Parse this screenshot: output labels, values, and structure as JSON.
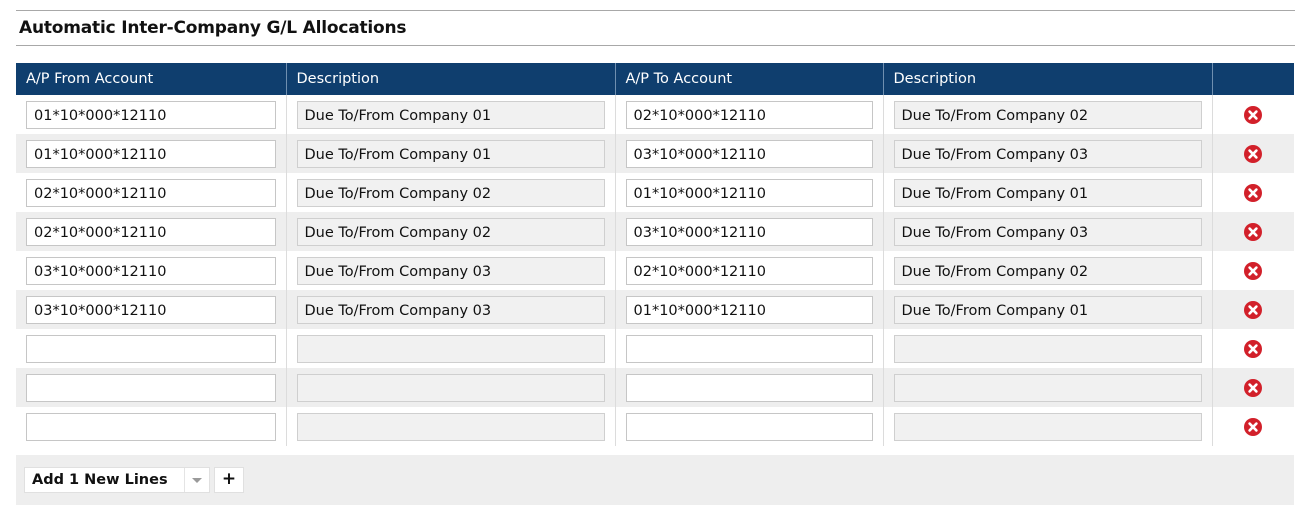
{
  "section": {
    "title": "Automatic Inter-Company G/L Allocations"
  },
  "table": {
    "headers": [
      "A/P From Account",
      "Description",
      "A/P To Account",
      "Description",
      ""
    ],
    "rows": [
      {
        "from_account": "01*10*000*12110",
        "from_description": "Due To/From Company 01",
        "to_account": "02*10*000*12110",
        "to_description": "Due To/From Company 02"
      },
      {
        "from_account": "01*10*000*12110",
        "from_description": "Due To/From Company 01",
        "to_account": "03*10*000*12110",
        "to_description": "Due To/From Company 03"
      },
      {
        "from_account": "02*10*000*12110",
        "from_description": "Due To/From Company 02",
        "to_account": "01*10*000*12110",
        "to_description": "Due To/From Company 01"
      },
      {
        "from_account": "02*10*000*12110",
        "from_description": "Due To/From Company 02",
        "to_account": "03*10*000*12110",
        "to_description": "Due To/From Company 03"
      },
      {
        "from_account": "03*10*000*12110",
        "from_description": "Due To/From Company 03",
        "to_account": "02*10*000*12110",
        "to_description": "Due To/From Company 02"
      },
      {
        "from_account": "03*10*000*12110",
        "from_description": "Due To/From Company 03",
        "to_account": "01*10*000*12110",
        "to_description": "Due To/From Company 01"
      },
      {
        "from_account": "",
        "from_description": "",
        "to_account": "",
        "to_description": ""
      },
      {
        "from_account": "",
        "from_description": "",
        "to_account": "",
        "to_description": ""
      },
      {
        "from_account": "",
        "from_description": "",
        "to_account": "",
        "to_description": ""
      }
    ],
    "delete_icon": "circle-x-icon"
  },
  "footer": {
    "add_lines_label": "Add 1 New Lines",
    "add_button_label": "+"
  },
  "colors": {
    "header_bg": "#0f3e6e",
    "delete_icon": "#d2202a",
    "alt_row": "#eeeeee"
  }
}
